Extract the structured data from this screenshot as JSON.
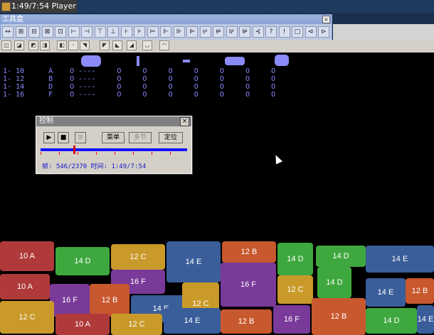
{
  "window": {
    "title": "1:49/7:54 Player"
  },
  "toolbox": {
    "title": "工具盒",
    "close": "×"
  },
  "toolbox_buttons": [
    "↔",
    "⊞",
    "⊟",
    "⊠",
    "⊡",
    "⊢",
    "⊣",
    "⊤",
    "⊥",
    "⊦",
    "⊧",
    "⊨",
    "⊩",
    "⊪",
    "⊫",
    "⊬",
    "⊭",
    "⊮",
    "⊯",
    "⊰",
    "?",
    "!",
    "□",
    "⊲",
    "⊳"
  ],
  "toolbar2_buttons": [
    "◫",
    "◪",
    "◩",
    "◨",
    "◧",
    "◦",
    "◥",
    "◤",
    "◣",
    "◢",
    "◡",
    "◠"
  ],
  "rows": [
    {
      "range": "1- 10",
      "letter": "A",
      "rest": "O ----     O     O     O     O     O     O     O"
    },
    {
      "range": "1- 12",
      "letter": "B",
      "rest": "O ----     O     O     O     O     O     O     O"
    },
    {
      "range": "1- 14",
      "letter": "D",
      "rest": "O ----     O     O     O     O     O     O     O"
    },
    {
      "range": "1- 16",
      "letter": "F",
      "rest": "O ----     O     O     O     O     O     O     O"
    }
  ],
  "control": {
    "title": "控制",
    "close": "×",
    "play_label": "▶",
    "pause_label": "■",
    "step_label": "⊞",
    "menu_label": "菜单",
    "multi_label": "多节",
    "locate_label": "定位",
    "frame_label": "帧:",
    "frame_value": "546/2370",
    "time_label": "时间:",
    "time_value": "1:49/7:54"
  },
  "pieces": [
    {
      "label": "10 A",
      "color": "#b03a3a"
    },
    {
      "label": "14 D",
      "color": "#3ea83e"
    },
    {
      "label": "12 C",
      "color": "#c99a2a"
    },
    {
      "label": "16 F",
      "color": "#7a3a9a"
    },
    {
      "label": "14 E",
      "color": "#3a5e9a"
    },
    {
      "label": "12 B",
      "color": "#c8582e"
    },
    {
      "label": "14 D",
      "color": "#3ea83e"
    },
    {
      "label": "14 D",
      "color": "#3ea83e"
    },
    {
      "label": "14 E",
      "color": "#3a5e9a"
    },
    {
      "label": "10 A",
      "color": "#b03a3a"
    },
    {
      "label": "16 F",
      "color": "#7a3a9a"
    },
    {
      "label": "12 B",
      "color": "#c8582e"
    },
    {
      "label": "14 E",
      "color": "#3a5e9a"
    },
    {
      "label": "12 C",
      "color": "#c99a2a"
    },
    {
      "label": "16 F",
      "color": "#7a3a9a"
    },
    {
      "label": "12 C",
      "color": "#c99a2a"
    },
    {
      "label": "14 D",
      "color": "#3ea83e"
    },
    {
      "label": "14 E",
      "color": "#3a5e9a"
    },
    {
      "label": "12 B",
      "color": "#c8582e"
    },
    {
      "label": "12 C",
      "color": "#c99a2a"
    },
    {
      "label": "10 A",
      "color": "#b03a3a"
    },
    {
      "label": "12 C",
      "color": "#c99a2a"
    },
    {
      "label": "14 E",
      "color": "#3a5e9a"
    },
    {
      "label": "12 B",
      "color": "#c8582e"
    },
    {
      "label": "16 F",
      "color": "#7a3a9a"
    },
    {
      "label": "12 B",
      "color": "#c8582e"
    },
    {
      "label": "14 D",
      "color": "#3ea83e"
    },
    {
      "label": "14 E",
      "color": "#3a5e9a"
    }
  ]
}
